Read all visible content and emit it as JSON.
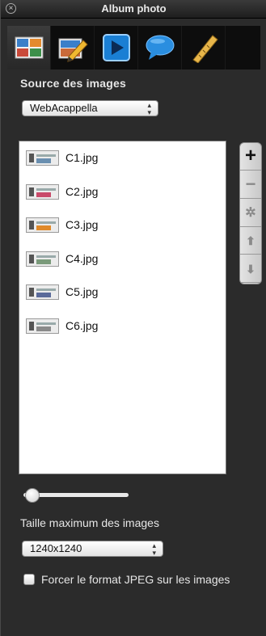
{
  "window": {
    "title": "Album photo"
  },
  "toolbar": {
    "tools": [
      {
        "icon": "images-icon",
        "active": true
      },
      {
        "icon": "edit-pencil-icon",
        "active": false
      },
      {
        "icon": "play-icon",
        "active": false
      },
      {
        "icon": "speech-bubble-icon",
        "active": false
      },
      {
        "icon": "ruler-icon",
        "active": false
      }
    ]
  },
  "source": {
    "label": "Source des images",
    "selected": "WebAcappella"
  },
  "images": [
    "C1.jpg",
    "C2.jpg",
    "C3.jpg",
    "C4.jpg",
    "C5.jpg",
    "C6.jpg"
  ],
  "list_controls": [
    {
      "icon": "plus-icon",
      "glyph": "+"
    },
    {
      "icon": "minus-icon",
      "glyph": "−"
    },
    {
      "icon": "gear-icon",
      "glyph": "✲"
    },
    {
      "icon": "arrow-up-icon",
      "glyph": "⬆"
    },
    {
      "icon": "arrow-down-icon",
      "glyph": "⬇"
    }
  ],
  "slider": {
    "value": 0.05
  },
  "size": {
    "label": "Taille maximum des images",
    "selected": "1240x1240"
  },
  "jpeg": {
    "label": "Forcer le format JPEG sur les images",
    "checked": false
  },
  "colors": {
    "panel": "#2b2b2b",
    "toolbar": "#0d0d0d",
    "accent_blue": "#1a7fd4"
  }
}
